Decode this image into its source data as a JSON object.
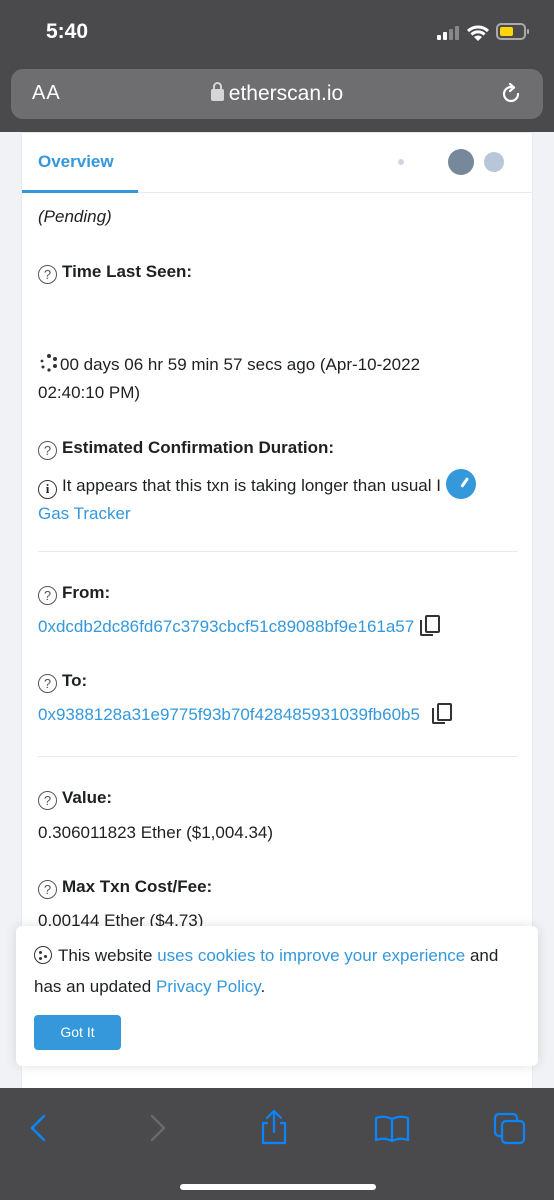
{
  "status_bar": {
    "time": "5:40"
  },
  "browser": {
    "text_size_label": "AA",
    "domain": "etherscan.io"
  },
  "tabs": {
    "overview": "Overview"
  },
  "tx": {
    "status": "(Pending)",
    "time_last_seen": {
      "label": "Time Last Seen:",
      "value_line1": "00 days 06 hr 59 min 57 secs ago (Apr-10-2022",
      "value_line2": "02:40:10 PM)"
    },
    "est_duration": {
      "label": "Estimated Confirmation Duration:",
      "message": "It appears that this txn is taking longer than usual I",
      "link": "Gas Tracker"
    },
    "from": {
      "label": "From:",
      "address": "0xdcdb2dc86fd67c3793cbcf51c89088bf9e161a57"
    },
    "to": {
      "label": "To:",
      "address": "0x9388128a31e9775f93b70f428485931039fb60b5"
    },
    "value": {
      "label": "Value:",
      "amount": "0.306011823 Ether ($1,004.34)"
    },
    "max_fee": {
      "label": "Max Txn Cost/Fee:",
      "amount": "0.00144 Ether ($4.73)"
    }
  },
  "cookie": {
    "t1": "This website ",
    "link1": "uses cookies to improve your experience",
    "t2": " and has an updated ",
    "link2": "Privacy Policy",
    "t3": ".",
    "button": "Got It"
  },
  "colors": {
    "link": "#3498db",
    "chrome": "#4a4a4c",
    "toolbar_icon": "#0a84ff"
  }
}
